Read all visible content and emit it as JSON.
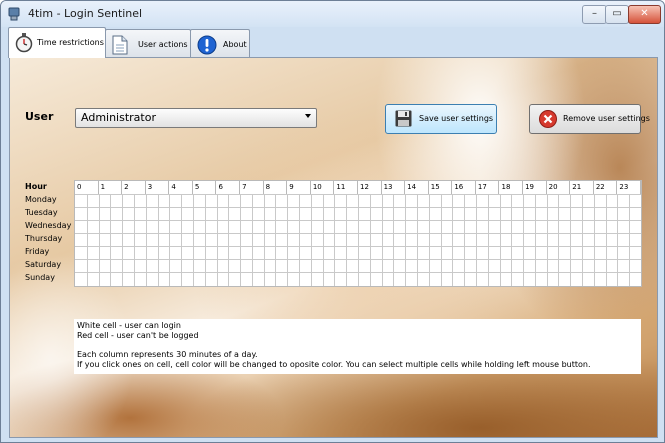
{
  "window": {
    "title": "4tim - Login Sentinel",
    "controls": [
      "–",
      "▭",
      "✕"
    ]
  },
  "tabs": [
    {
      "label": "Time restrictions",
      "icon": "stopwatch-icon"
    },
    {
      "label": "User actions",
      "icon": "document-icon"
    },
    {
      "label": "About",
      "icon": "info-icon"
    }
  ],
  "user": {
    "label": "User",
    "selected": "Administrator"
  },
  "buttons": {
    "save": "Save user settings",
    "remove": "Remove user settings"
  },
  "schedule": {
    "hour_label": "Hour",
    "hours": [
      "0",
      "1",
      "2",
      "3",
      "4",
      "5",
      "6",
      "7",
      "8",
      "9",
      "10",
      "11",
      "12",
      "13",
      "14",
      "15",
      "16",
      "17",
      "18",
      "19",
      "20",
      "21",
      "22",
      "23"
    ],
    "days": [
      "Monday",
      "Tuesday",
      "Wednesday",
      "Thursday",
      "Friday",
      "Saturday",
      "Sunday"
    ]
  },
  "info": {
    "line1": "White cell - user can login",
    "line2": "Red cell - user can't be logged",
    "line3": "Each column represents 30 minutes of a day.",
    "line4": "If you click ones on cell, cell color will be changed to oposite color. You can select multiple cells while holding left mouse button."
  }
}
